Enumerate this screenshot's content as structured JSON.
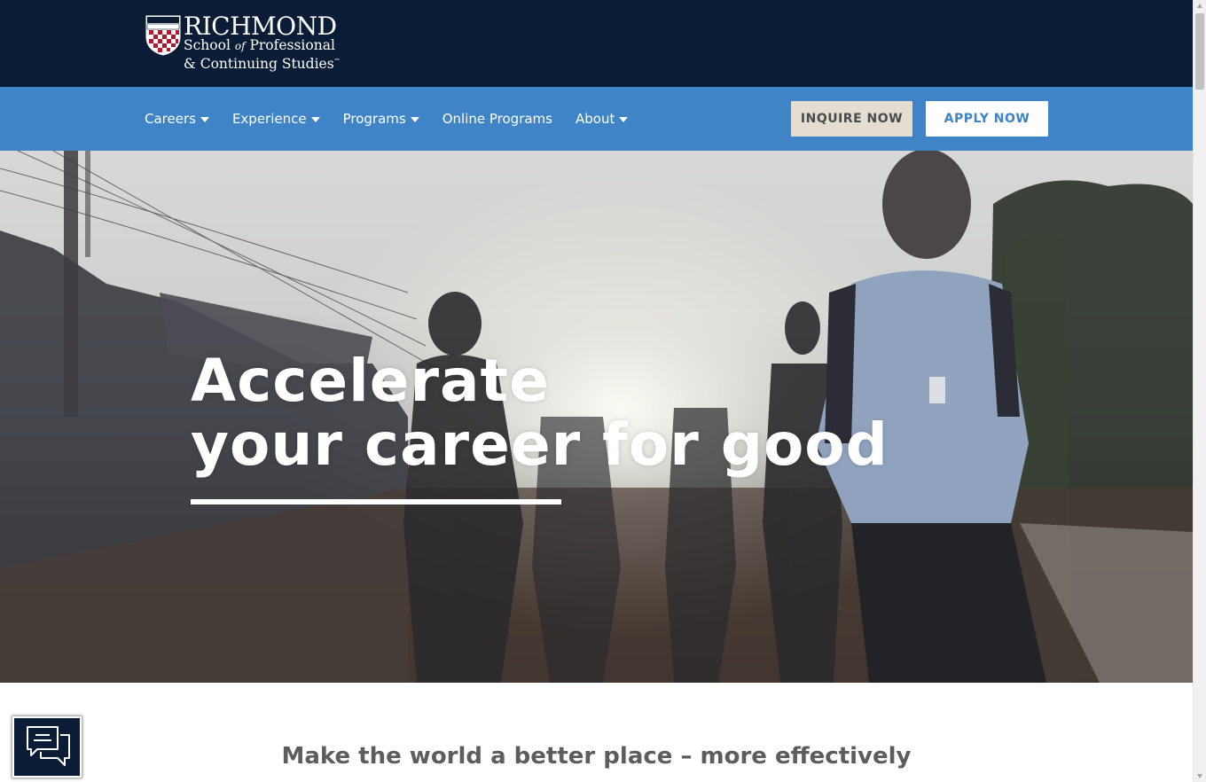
{
  "header": {
    "logo": {
      "name": "RICHMOND",
      "line1_prefix": "School ",
      "line1_of": "of",
      "line1_suffix": " Professional",
      "line2": "& Continuing Studies",
      "trademark": "™",
      "icon": "university-shield-icon"
    }
  },
  "nav": {
    "items": [
      {
        "label": "Careers",
        "has_dropdown": true
      },
      {
        "label": "Experience",
        "has_dropdown": true
      },
      {
        "label": "Programs",
        "has_dropdown": true
      },
      {
        "label": "Online Programs",
        "has_dropdown": false
      },
      {
        "label": "About",
        "has_dropdown": true
      }
    ],
    "inquire_label": "INQUIRE NOW",
    "apply_label": "APPLY NOW"
  },
  "hero": {
    "title_line1": "Accelerate",
    "title_line2": "your career for good"
  },
  "main": {
    "tagline": "Make the world a better place – more effectively"
  },
  "chat": {
    "icon": "chat-bubbles-icon"
  },
  "colors": {
    "header_bg": "#0b1d36",
    "nav_bg": "#3e84c6",
    "inquire_bg": "#e4ddd2",
    "apply_text": "#3e84c6",
    "tagline_text": "#5d5d5d"
  }
}
